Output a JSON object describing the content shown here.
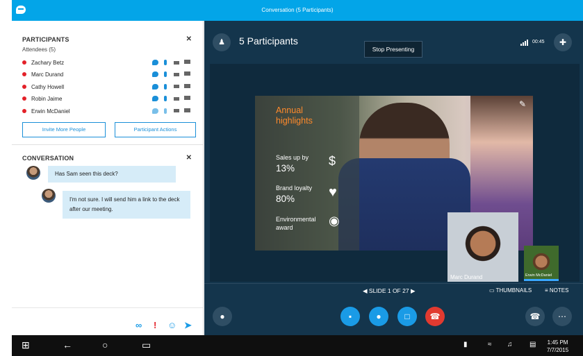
{
  "window": {
    "title": "Conversation (5 Participants)"
  },
  "participants_panel": {
    "title": "PARTICIPANTS",
    "close_glyph": "✕",
    "attendees_label": "Attendees (5)",
    "people": [
      {
        "name": "Zachary Betz",
        "status_color": "#e32129"
      },
      {
        "name": "Marc Durand",
        "status_color": "#e32129"
      },
      {
        "name": "Cathy Howell",
        "status_color": "#e32129"
      },
      {
        "name": "Robin Jaime",
        "status_color": "#e32129"
      },
      {
        "name": "Erwin McDaniel",
        "status_color": "#e32129"
      }
    ],
    "invite_button": "Invite More People",
    "actions_button": "Participant Actions"
  },
  "conversation_panel": {
    "title": "CONVERSATION",
    "close_glyph": "✕",
    "messages": [
      {
        "text": "Has Sam seen this deck?"
      },
      {
        "text": "I'm not sure. I will send him a link to the deck after our meeting."
      }
    ],
    "compose_icons": [
      "attachment-icon",
      "importance-icon",
      "emoji-icon",
      "send-icon"
    ]
  },
  "stage": {
    "title": "5 Participants",
    "stop_presenting": "Stop Presenting",
    "elapsed": "00:45",
    "slide": {
      "heading": "Annual highlights",
      "items": [
        {
          "label": "Sales up by",
          "value": "13%",
          "icon": "dollar-icon"
        },
        {
          "label": "Brand loyalty",
          "value": "80%",
          "icon": "heart-icon"
        },
        {
          "label": "Environmental award",
          "value": "",
          "icon": "globe-award-icon"
        }
      ]
    },
    "videos": [
      {
        "name": "Marc Durand"
      },
      {
        "name": "Erwin McDaniel"
      }
    ],
    "slide_nav": "SLIDE 1 OF 27",
    "thumbnails": "THUMBNAILS",
    "notes": "NOTES"
  },
  "controls": {
    "accent": "#1a9be6",
    "hangup_color": "#e13a30"
  },
  "taskbar": {
    "time": "1:45 PM",
    "date": "7/7/2015"
  }
}
